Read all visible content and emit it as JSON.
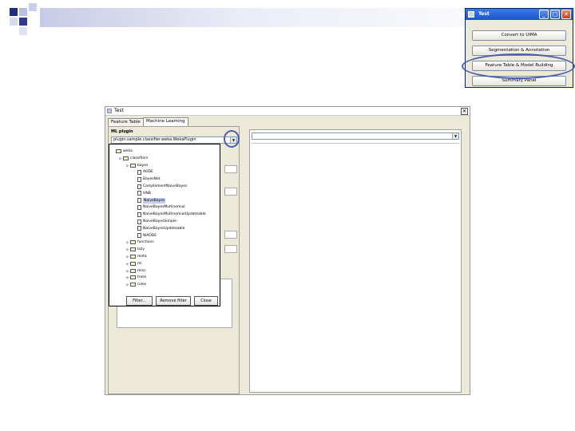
{
  "colors": {
    "title_blue": "#1d55c9",
    "highlight": "#4d5ea8",
    "panel_bg": "#ece9d8"
  },
  "mini_window": {
    "title": "Test",
    "buttons": [
      "Convert to UIMA",
      "Segmentation & Annotation",
      "Feature Table & Model Building",
      "Summary Panel"
    ]
  },
  "main_window": {
    "title": "Test",
    "tabs": [
      "Feature Table",
      "Machine Learning"
    ],
    "ml_plugin_label": "ML plugin",
    "ml_plugin_value": "plugin.sample.classifier.weka.WekaPlugin",
    "tree": [
      {
        "label": "weka",
        "depth": 0,
        "kind": "folder",
        "toggle": ""
      },
      {
        "label": "classifiers",
        "depth": 1,
        "kind": "folder",
        "toggle": "o-"
      },
      {
        "label": "bayes",
        "depth": 2,
        "kind": "folder",
        "toggle": "o-"
      },
      {
        "label": "AODE",
        "depth": 3,
        "kind": "leaf",
        "toggle": ""
      },
      {
        "label": "BayesNet",
        "depth": 3,
        "kind": "leaf",
        "toggle": ""
      },
      {
        "label": "ComplementNaiveBayes",
        "depth": 3,
        "kind": "leaf",
        "toggle": ""
      },
      {
        "label": "HNB",
        "depth": 3,
        "kind": "leaf",
        "toggle": ""
      },
      {
        "label": "NaiveBayes",
        "depth": 3,
        "kind": "leaf",
        "toggle": "",
        "selected": true
      },
      {
        "label": "NaiveBayesMultinomial",
        "depth": 3,
        "kind": "leaf",
        "toggle": ""
      },
      {
        "label": "NaiveBayesMultinomialUpdateable",
        "depth": 3,
        "kind": "leaf",
        "toggle": ""
      },
      {
        "label": "NaiveBayesSimple",
        "depth": 3,
        "kind": "leaf",
        "toggle": ""
      },
      {
        "label": "NaiveBayesUpdateable",
        "depth": 3,
        "kind": "leaf",
        "toggle": ""
      },
      {
        "label": "WAODE",
        "depth": 3,
        "kind": "leaf",
        "toggle": ""
      },
      {
        "label": "functions",
        "depth": 2,
        "kind": "folder",
        "toggle": "o-"
      },
      {
        "label": "lazy",
        "depth": 2,
        "kind": "folder",
        "toggle": "o-"
      },
      {
        "label": "meta",
        "depth": 2,
        "kind": "folder",
        "toggle": "o-"
      },
      {
        "label": "mi",
        "depth": 2,
        "kind": "folder",
        "toggle": "o-"
      },
      {
        "label": "misc",
        "depth": 2,
        "kind": "folder",
        "toggle": "o-"
      },
      {
        "label": "trees",
        "depth": 2,
        "kind": "folder",
        "toggle": "o-"
      },
      {
        "label": "rules",
        "depth": 2,
        "kind": "folder",
        "toggle": "o-"
      }
    ],
    "popup_buttons": [
      "Filter...",
      "Remove filter",
      "Close"
    ]
  }
}
